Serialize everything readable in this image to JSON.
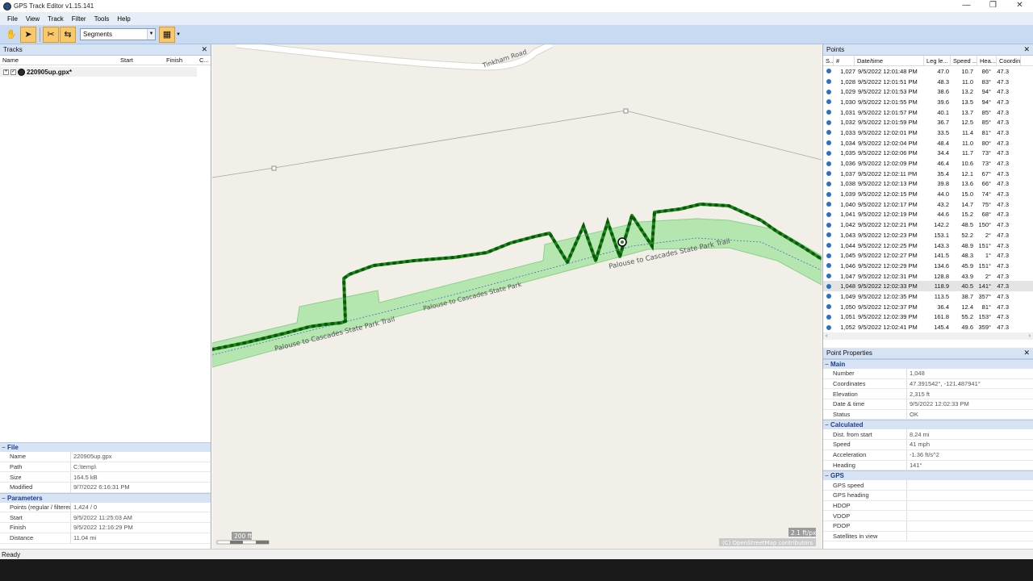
{
  "window": {
    "title": "GPS Track Editor v1.15.141",
    "minimize": "—",
    "restore": "❐",
    "close": "✕"
  },
  "menu": [
    "File",
    "View",
    "Track",
    "Filter",
    "Tools",
    "Help"
  ],
  "toolbar": {
    "mode_value": "Segments"
  },
  "tracks": {
    "title": "Tracks",
    "columns": [
      "Name",
      "Start",
      "Finish",
      "C..."
    ],
    "items": [
      {
        "name": "220905up.gpx*"
      }
    ]
  },
  "file_props": {
    "section": "File",
    "rows": [
      {
        "k": "Name",
        "v": "220905up.gpx"
      },
      {
        "k": "Path",
        "v": "C:\\temp\\"
      },
      {
        "k": "Size",
        "v": "164.5 kB"
      },
      {
        "k": "Modified",
        "v": "9/7/2022 6:16:31 PM"
      }
    ],
    "section2": "Parameters",
    "rows2": [
      {
        "k": "Points (regular / filtered)",
        "v": "1,424 / 0"
      },
      {
        "k": "Start",
        "v": "9/5/2022 11:25:03 AM"
      },
      {
        "k": "Finish",
        "v": "9/5/2022 12:16:29 PM"
      },
      {
        "k": "Distance",
        "v": "11.04 mi"
      }
    ]
  },
  "map": {
    "road_label": "Tinkham Road",
    "trail_label_1": "Palouse to Cascades State Park Trail",
    "trail_label_2": "Palouse to Cascades State Park",
    "trail_label_3": "Palouse to Cascades State Park Trail",
    "scale": "200 ft",
    "zoom": "2.1 ft/px",
    "attribution": "(C) OpenStreetMap contributors"
  },
  "points": {
    "title": "Points",
    "columns": [
      "S...",
      "#",
      "Date/time",
      "Leg le...",
      "Speed ...",
      "Hea...",
      "Coordin"
    ],
    "rows": [
      [
        "1,027",
        "9/5/2022 12:01:48 PM",
        "47.0",
        "10.7",
        "86°",
        "47.3"
      ],
      [
        "1,028",
        "9/5/2022 12:01:51 PM",
        "48.3",
        "11.0",
        "83°",
        "47.3"
      ],
      [
        "1,029",
        "9/5/2022 12:01:53 PM",
        "38.6",
        "13.2",
        "94°",
        "47.3"
      ],
      [
        "1,030",
        "9/5/2022 12:01:55 PM",
        "39.6",
        "13.5",
        "94°",
        "47.3"
      ],
      [
        "1,031",
        "9/5/2022 12:01:57 PM",
        "40.1",
        "13.7",
        "85°",
        "47.3"
      ],
      [
        "1,032",
        "9/5/2022 12:01:59 PM",
        "36.7",
        "12.5",
        "85°",
        "47.3"
      ],
      [
        "1,033",
        "9/5/2022 12:02:01 PM",
        "33.5",
        "11.4",
        "81°",
        "47.3"
      ],
      [
        "1,034",
        "9/5/2022 12:02:04 PM",
        "48.4",
        "11.0",
        "80°",
        "47.3"
      ],
      [
        "1,035",
        "9/5/2022 12:02:06 PM",
        "34.4",
        "11.7",
        "73°",
        "47.3"
      ],
      [
        "1,036",
        "9/5/2022 12:02:09 PM",
        "46.4",
        "10.6",
        "73°",
        "47.3"
      ],
      [
        "1,037",
        "9/5/2022 12:02:11 PM",
        "35.4",
        "12.1",
        "67°",
        "47.3"
      ],
      [
        "1,038",
        "9/5/2022 12:02:13 PM",
        "39.8",
        "13.6",
        "66°",
        "47.3"
      ],
      [
        "1,039",
        "9/5/2022 12:02:15 PM",
        "44.0",
        "15.0",
        "74°",
        "47.3"
      ],
      [
        "1,040",
        "9/5/2022 12:02:17 PM",
        "43.2",
        "14.7",
        "75°",
        "47.3"
      ],
      [
        "1,041",
        "9/5/2022 12:02:19 PM",
        "44.6",
        "15.2",
        "68°",
        "47.3"
      ],
      [
        "1,042",
        "9/5/2022 12:02:21 PM",
        "142.2",
        "48.5",
        "150°",
        "47.3"
      ],
      [
        "1,043",
        "9/5/2022 12:02:23 PM",
        "153.1",
        "52.2",
        "2°",
        "47.3"
      ],
      [
        "1,044",
        "9/5/2022 12:02:25 PM",
        "143.3",
        "48.9",
        "151°",
        "47.3"
      ],
      [
        "1,045",
        "9/5/2022 12:02:27 PM",
        "141.5",
        "48.3",
        "1°",
        "47.3"
      ],
      [
        "1,046",
        "9/5/2022 12:02:29 PM",
        "134.6",
        "45.9",
        "151°",
        "47.3"
      ],
      [
        "1,047",
        "9/5/2022 12:02:31 PM",
        "128.8",
        "43.9",
        "2°",
        "47.3"
      ],
      [
        "1,048",
        "9/5/2022 12:02:33 PM",
        "118.9",
        "40.5",
        "141°",
        "47.3"
      ],
      [
        "1,049",
        "9/5/2022 12:02:35 PM",
        "113.5",
        "38.7",
        "357°",
        "47.3"
      ],
      [
        "1,050",
        "9/5/2022 12:02:37 PM",
        "36.4",
        "12.4",
        "81°",
        "47.3"
      ],
      [
        "1,051",
        "9/5/2022 12:02:39 PM",
        "161.8",
        "55.2",
        "153°",
        "47.3"
      ],
      [
        "1,052",
        "9/5/2022 12:02:41 PM",
        "145.4",
        "49.6",
        "359°",
        "47.3"
      ]
    ],
    "selected_index": 21
  },
  "point_props": {
    "title": "Point Properties",
    "sections": [
      {
        "name": "Main",
        "rows": [
          {
            "k": "Number",
            "v": "1,048"
          },
          {
            "k": "Coordinates",
            "v": "47.391542°, -121.487941°"
          },
          {
            "k": "Elevation",
            "v": "2,315 ft"
          },
          {
            "k": "Date & time",
            "v": "9/5/2022 12:02:33 PM"
          },
          {
            "k": "Status",
            "v": "OK"
          }
        ]
      },
      {
        "name": "Calculated",
        "rows": [
          {
            "k": "Dist. from start",
            "v": "8.24 mi"
          },
          {
            "k": "Speed",
            "v": "41 mph"
          },
          {
            "k": "Acceleration",
            "v": "-1.36 ft/s^2"
          },
          {
            "k": "Heading",
            "v": "141°"
          }
        ]
      },
      {
        "name": "GPS",
        "rows": [
          {
            "k": "GPS speed",
            "v": ""
          },
          {
            "k": "GPS heading",
            "v": ""
          },
          {
            "k": "HDOP",
            "v": ""
          },
          {
            "k": "VDOP",
            "v": ""
          },
          {
            "k": "PDOP",
            "v": ""
          },
          {
            "k": "Satellites in view",
            "v": ""
          }
        ]
      }
    ]
  },
  "status": "Ready"
}
